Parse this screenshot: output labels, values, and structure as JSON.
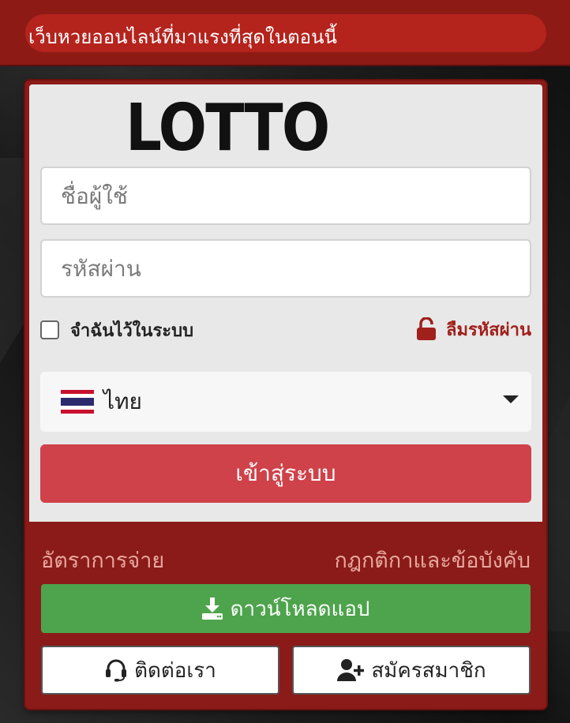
{
  "header": {
    "marquee_text": "เว็บหวยออนไลน์ที่มาแรงที่สุดในตอนนี้"
  },
  "logo": {
    "text": "LOTTO"
  },
  "login_form": {
    "username_placeholder": "ชื่อผู้ใช้",
    "password_placeholder": "รหัสผ่าน",
    "remember_label": "จำฉันไว้ในระบบ",
    "forgot_label": "ลืมรหัสผ่าน",
    "language_selected": "ไทย",
    "login_label": "เข้าสู่ระบบ"
  },
  "footer_links": {
    "payout_rates": "อัตราการจ่าย",
    "rules": "กฎกติกาและข้อบังคับ"
  },
  "actions": {
    "download_label": "ดาวน์โหลดแอป",
    "contact_label": "ติดต่อเรา",
    "register_label": "สมัครสมาชิก"
  },
  "icons": {
    "forgot": "unlock-icon",
    "language": "thai-flag-icon",
    "dropdown": "caret-down-icon",
    "download": "download-icon",
    "contact": "headset-icon",
    "register": "user-plus-icon"
  },
  "colors": {
    "brand_red": "#8e1a16",
    "marquee_red": "#b5231d",
    "login_button": "#cf424a",
    "download_button": "#4ea44c",
    "link_text": "#e7a79d",
    "forgot_text": "#a0201b"
  }
}
